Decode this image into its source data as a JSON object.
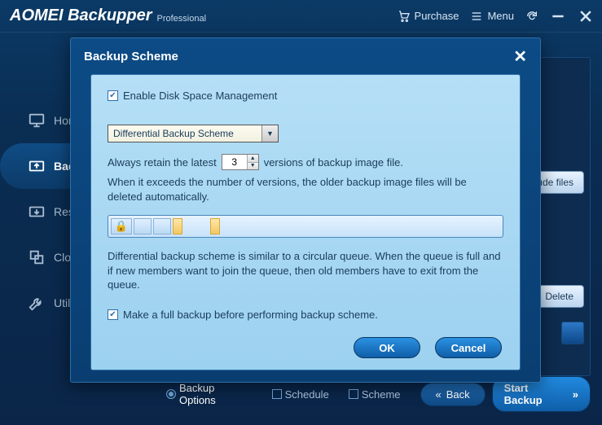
{
  "app": {
    "name": "AOMEI Backupper",
    "edition": "Professional"
  },
  "titlebar": {
    "purchase": "Purchase",
    "menu": "Menu"
  },
  "sidebar": {
    "items": [
      {
        "label": "Home"
      },
      {
        "label": "Backup"
      },
      {
        "label": "Restore"
      },
      {
        "label": "Clone"
      },
      {
        "label": "Utilities"
      }
    ]
  },
  "background": {
    "add_files": "ude files",
    "delete": "Delete"
  },
  "bottom": {
    "options": "Backup Options",
    "schedule": "Schedule",
    "scheme": "Scheme",
    "back": "Back",
    "start": "Start Backup"
  },
  "dialog": {
    "title": "Backup Scheme",
    "enable": "Enable Disk Space Management",
    "scheme_selected": "Differential Backup Scheme",
    "retain_pre": "Always retain the latest",
    "retain_value": "3",
    "retain_post": "versions of backup image file.",
    "retain_desc": "When it exceeds the number of versions, the older backup image files will be deleted automatically.",
    "explain": "Differential backup scheme is similar to a circular queue. When the queue is full and if new members want to join the queue, then old members have to exit from the queue.",
    "full_backup": "Make a full backup before performing backup scheme.",
    "ok": "OK",
    "cancel": "Cancel"
  }
}
